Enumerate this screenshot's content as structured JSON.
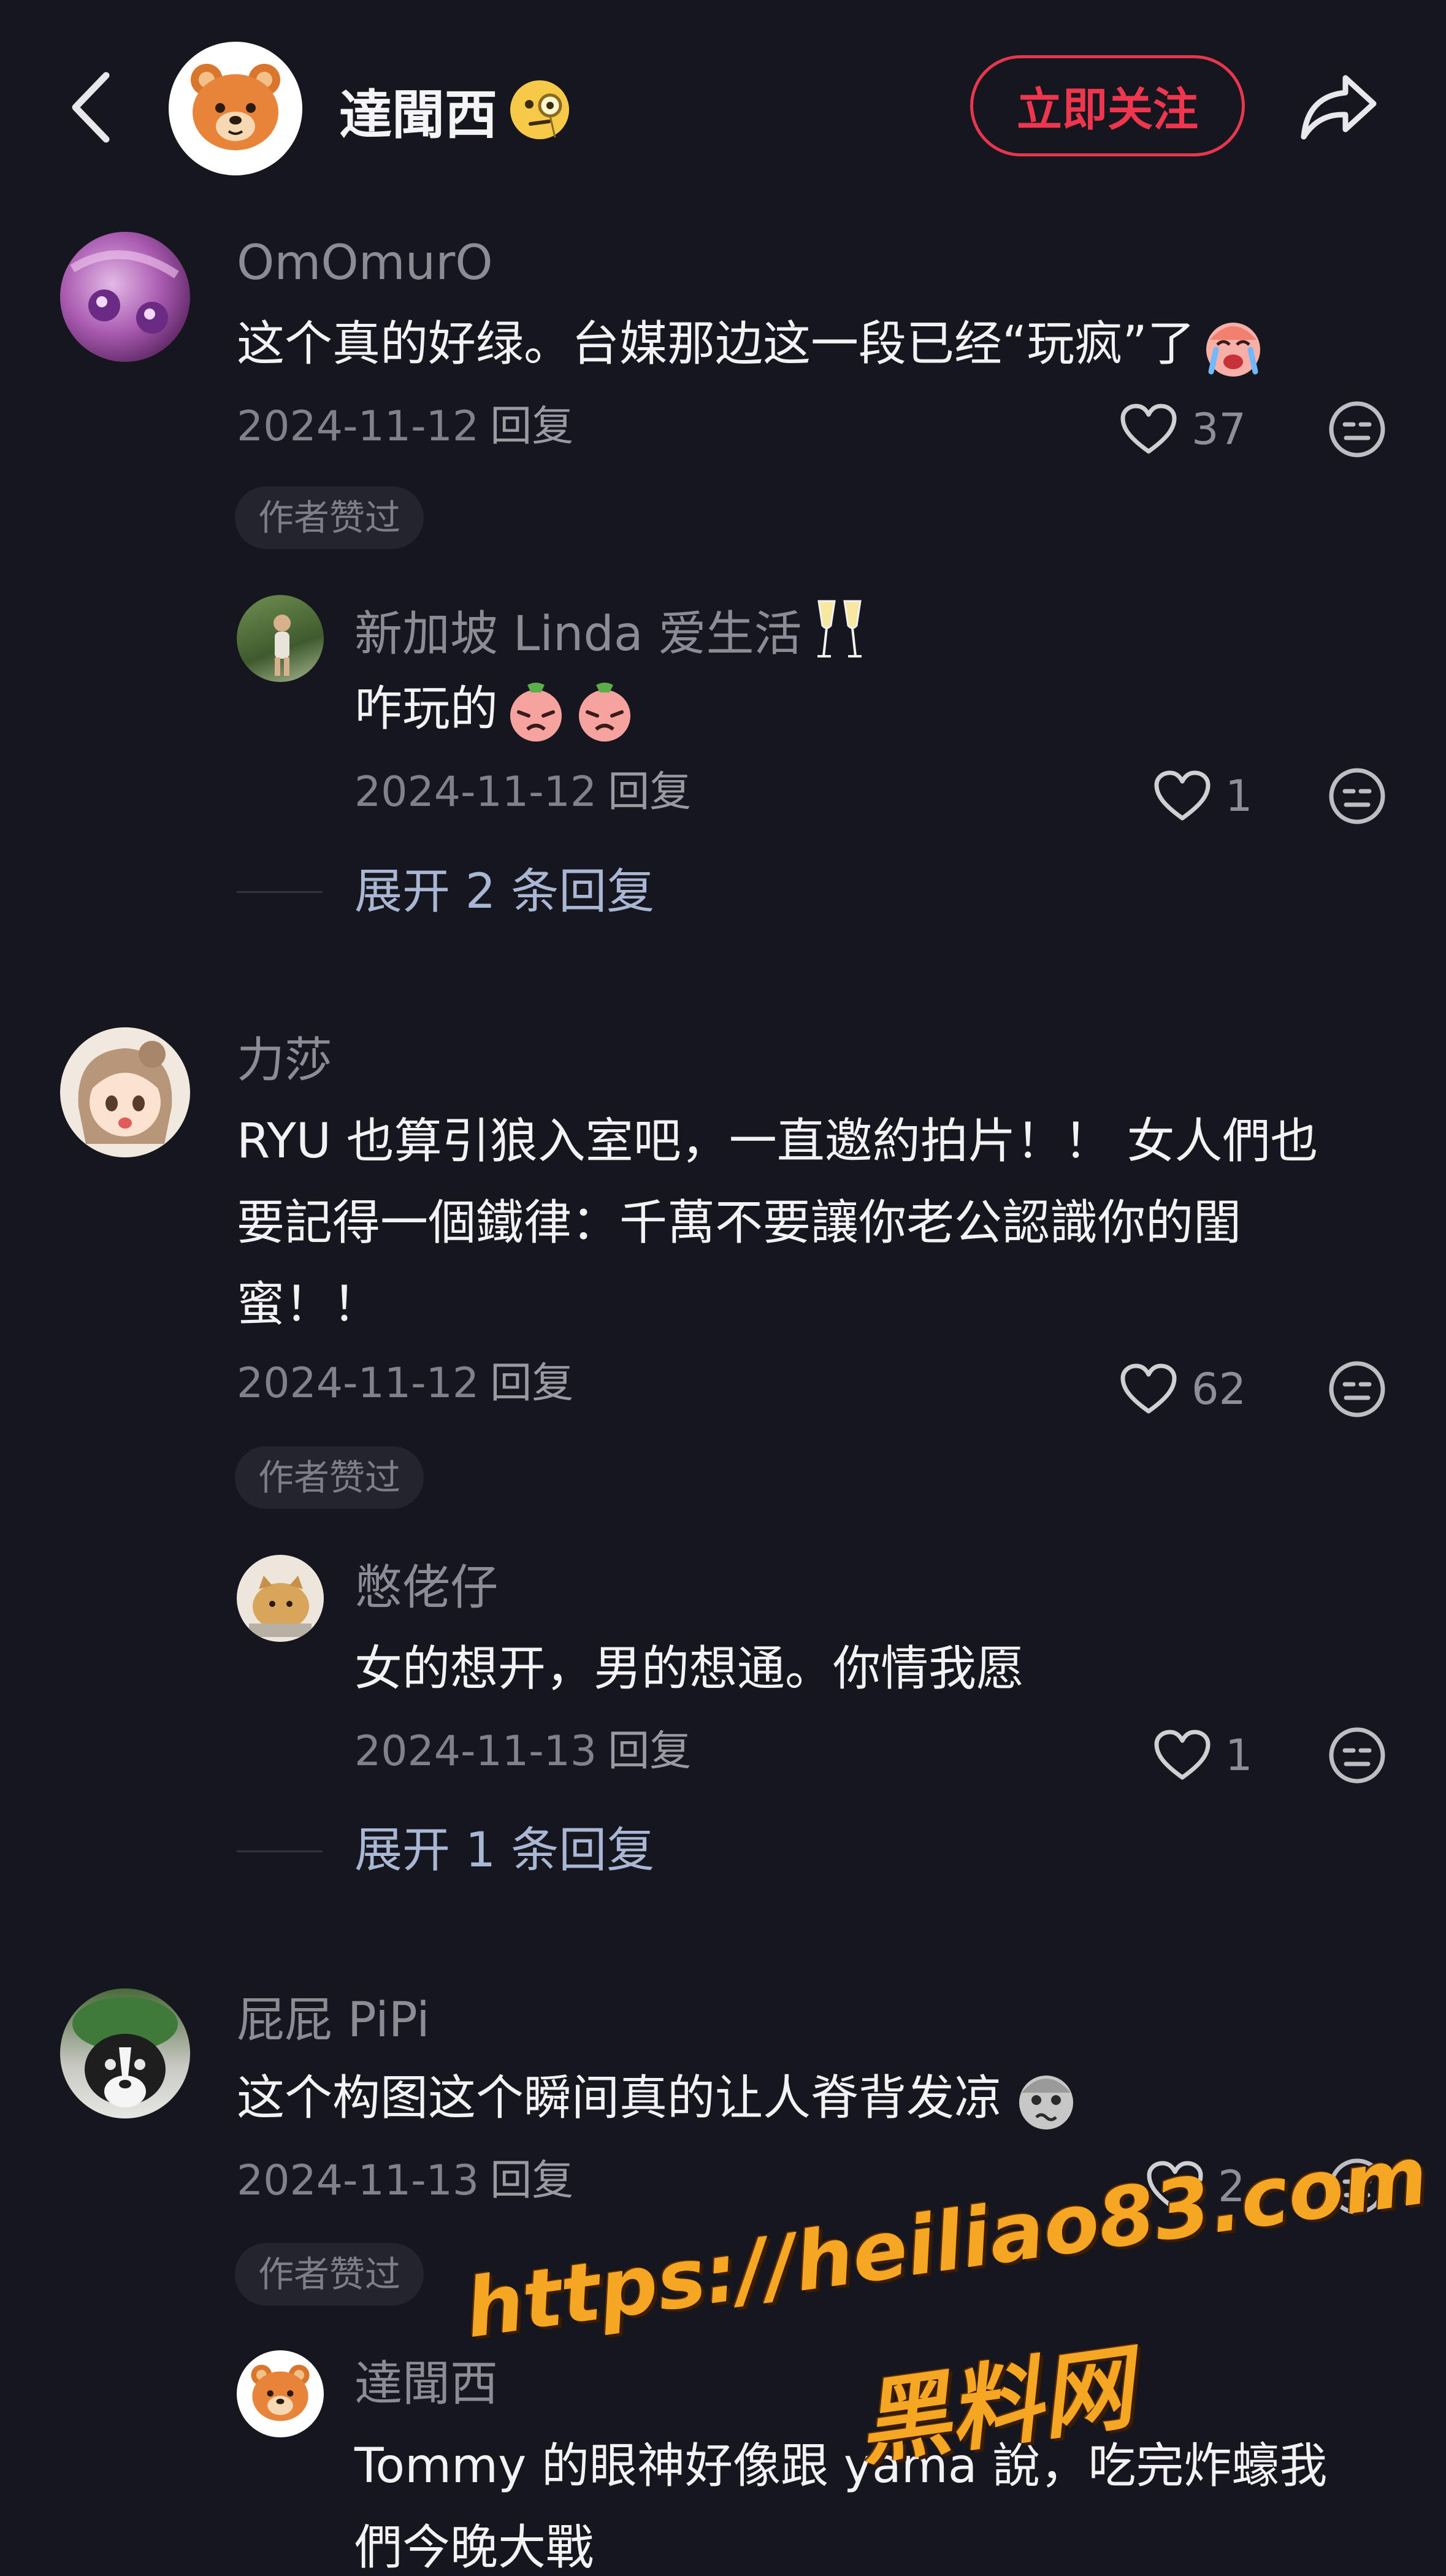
{
  "header": {
    "username": "達聞西",
    "follow_label": "立即关注",
    "back_icon": "chevron-left-icon",
    "share_icon": "share-arrow-icon",
    "colors": {
      "follow": "#e8364f",
      "background": "#16161e"
    }
  },
  "comments": [
    {
      "username": "OmOmurO",
      "text": "这个真的好绿。台媒那边这一段已经“玩疯”了",
      "date": "2024-11-12",
      "reply_label": "回复",
      "likes": "37",
      "badge": "作者赞过",
      "replies": [
        {
          "username": "新加坡 Linda 爱生活",
          "text": "咋玩的",
          "date": "2024-11-12",
          "reply_label": "回复",
          "likes": "1"
        }
      ],
      "expand_label": "展开 2 条回复"
    },
    {
      "username": "力莎",
      "text_lines": [
        "RYU 也算引狼入室吧，一直邀約拍片！！ 女人們也",
        "要記得一個鐵律：千萬不要讓你老公認識你的閨",
        "蜜！！"
      ],
      "date": "2024-11-12",
      "reply_label": "回复",
      "likes": "62",
      "badge": "作者赞过",
      "replies": [
        {
          "username": "憋佬仔",
          "text": "女的想开，男的想通。你情我愿",
          "date": "2024-11-13",
          "reply_label": "回复",
          "likes": "1"
        }
      ],
      "expand_label": "展开 1 条回复"
    },
    {
      "username": "屁屁 PiPi",
      "text": "这个构图这个瞬间真的让人脊背发凉",
      "date": "2024-11-13",
      "reply_label": "回复",
      "likes": "2",
      "badge": "作者赞过",
      "replies": [
        {
          "username": "達聞西",
          "text_lines": [
            "Tommy 的眼神好像跟 yama 說，吃完炸蠔我",
            "們今晚大戰"
          ]
        }
      ]
    }
  ],
  "watermark": {
    "url": "https://heiliao83.com",
    "name": "黑料网"
  }
}
